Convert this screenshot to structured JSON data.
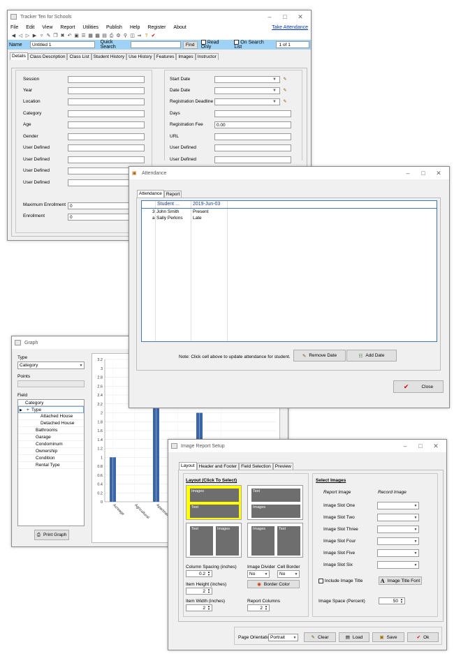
{
  "main": {
    "title": "Tracker Ten for Schools",
    "menu": [
      "File",
      "Edit",
      "View",
      "Report",
      "Utilities",
      "Publish",
      "Help",
      "Register",
      "About"
    ],
    "take_attendance": "Take Attendance",
    "name_label": "Name",
    "name_value": "Untitled 1",
    "quick_search": "Quick Search",
    "find": "Find",
    "read_only": "Read Only",
    "on_search_list": "On Search List",
    "record_count": "1 of 1",
    "tabs": [
      "Details",
      "Class Description",
      "Class List",
      "Student History",
      "Use History",
      "Features",
      "Images",
      "Instructor"
    ],
    "left_labels": [
      "Session",
      "Year",
      "Location",
      "Category",
      "Age",
      "Gender",
      "User Defined",
      "User Defined",
      "User Defined",
      "User Defined"
    ],
    "max_enroll_label": "Maximum Enrollment",
    "max_enroll_value": "0",
    "enroll_label": "Enrollment",
    "enroll_value": "0",
    "right_labels": [
      "Start Date",
      "Date Date",
      "Registration Deadline",
      "Days",
      "Registration Fee",
      "URL",
      "User Defined",
      "User Defined"
    ],
    "fee_value": "0.00"
  },
  "attendance": {
    "title": "Attendance",
    "tabs": [
      "Attendance",
      "Report"
    ],
    "col_student": "Student ...",
    "col_date": "2019-Jun-03",
    "rows": [
      {
        "id": "3",
        "name": "John Smith",
        "status": "Present"
      },
      {
        "id": "a",
        "name": "Sally Perkins",
        "status": "Late"
      }
    ],
    "note": "Note: Click cell above to update attendance for student.",
    "remove_date": "Remove Date",
    "add_date": "Add Date",
    "close": "Close"
  },
  "graph": {
    "title": "Graph",
    "type_label": "Type",
    "type_value": "Category",
    "points_label": "Points",
    "field_label": "Field",
    "field_header": "Category",
    "field_rows": [
      {
        "text": "Type",
        "indent": 0,
        "expander": "+",
        "selected": true
      },
      {
        "text": "Attached House",
        "indent": 2,
        "expander": "",
        "selected": false
      },
      {
        "text": "Detached House",
        "indent": 2,
        "expander": "",
        "selected": false
      },
      {
        "text": "Bathrooms",
        "indent": 1,
        "expander": "",
        "selected": false
      },
      {
        "text": "Garage",
        "indent": 1,
        "expander": "",
        "selected": false
      },
      {
        "text": "Condominum",
        "indent": 1,
        "expander": "",
        "selected": false
      },
      {
        "text": "Ownership",
        "indent": 1,
        "expander": "",
        "selected": false
      },
      {
        "text": "Condition",
        "indent": 1,
        "expander": "",
        "selected": false
      },
      {
        "text": "Rental Type",
        "indent": 1,
        "expander": "",
        "selected": false
      }
    ],
    "print_graph": "Print Graph",
    "bar_color": "#3a66a8"
  },
  "chart_data": {
    "type": "bar",
    "categories": [
      "Acreage",
      "Agricultural",
      "Apartment",
      "Attached House",
      "Detached Hou...",
      "Mobile..."
    ],
    "values": [
      1,
      0,
      2.1,
      0,
      2,
      0
    ],
    "yticks": [
      "0",
      "0.2",
      "0.4",
      "0.6",
      "0.8",
      "1",
      "1.2",
      "1.4",
      "1.6",
      "1.8",
      "2",
      "2.2",
      "2.4",
      "2.6",
      "2.8",
      "3",
      "3.2"
    ],
    "ylim": [
      0,
      3.2
    ],
    "grid": true
  },
  "image_report": {
    "title": "Image Report Setup",
    "tabs": [
      "Layout",
      "Header and Footer",
      "Field Selection",
      "Preview"
    ],
    "layout_heading": "Layout (Click To Select)",
    "select_images_heading": "Select Images",
    "report_image_col": "Report Image",
    "record_image_col": "Record Image",
    "slot_images": "Images",
    "slot_text": "Text",
    "image_slots": [
      "Image Slot One",
      "Image Slot Two",
      "Image Slot Three",
      "Image Slot Four",
      "Image Slot Five",
      "Image Slot Six"
    ],
    "column_spacing_label": "Column Spacing (inches)",
    "column_spacing_value": "0.2",
    "image_divider_label": "Image Divider",
    "image_divider_value": "No",
    "cell_border_label": "Cell Border",
    "cell_border_value": "No",
    "item_height_label": "Item Height (inches)",
    "item_height_value": "2",
    "border_color": "Border Color",
    "item_width_label": "Item Width (inches)",
    "item_width_value": "2",
    "report_columns_label": "Report Columns",
    "report_columns_value": "2",
    "include_image_title": "Include Image Title",
    "image_title_font": "Image Title Font",
    "image_space_label": "Image Space (Percent)",
    "image_space_value": "50",
    "page_orientation_label": "Page Orientation",
    "page_orientation_value": "Portrait",
    "clear": "Clear",
    "load": "Load",
    "save": "Save",
    "ok": "Ok",
    "highlight_color": "#ffff00"
  }
}
